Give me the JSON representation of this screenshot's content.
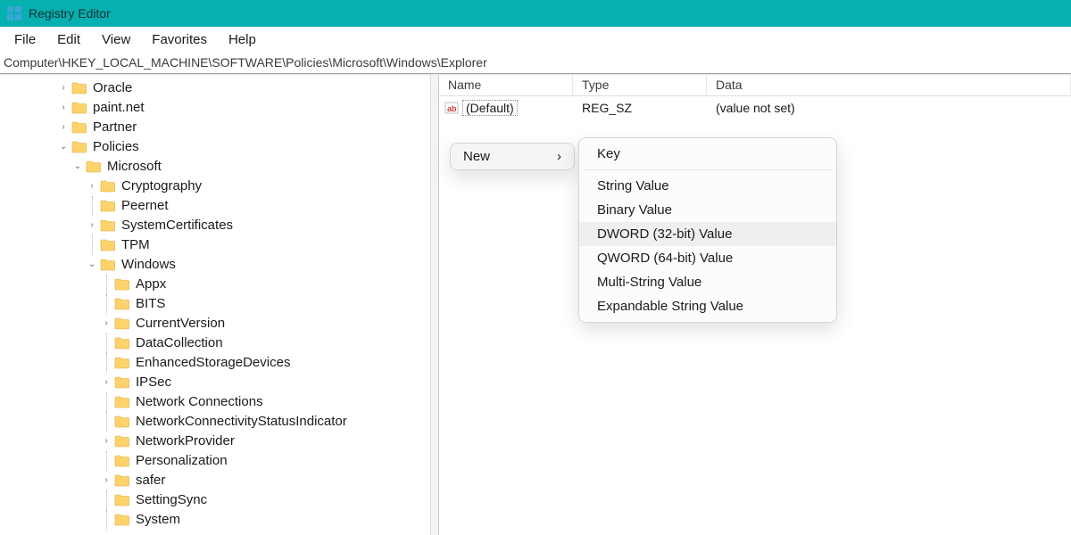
{
  "app": {
    "title": "Registry Editor"
  },
  "menu": {
    "items": [
      "File",
      "Edit",
      "View",
      "Favorites",
      "Help"
    ]
  },
  "path": "Computer\\HKEY_LOCAL_MACHINE\\SOFTWARE\\Policies\\Microsoft\\Windows\\Explorer",
  "tree": [
    {
      "indent": 4,
      "expander": ">",
      "label": "Oracle"
    },
    {
      "indent": 4,
      "expander": ">",
      "label": "paint.net"
    },
    {
      "indent": 4,
      "expander": ">",
      "label": "Partner"
    },
    {
      "indent": 4,
      "expander": "v",
      "label": "Policies"
    },
    {
      "indent": 5,
      "expander": "v",
      "label": "Microsoft"
    },
    {
      "indent": 6,
      "expander": ">",
      "label": "Cryptography"
    },
    {
      "indent": 6,
      "expander": "",
      "label": "Peernet",
      "dotted": true
    },
    {
      "indent": 6,
      "expander": ">",
      "label": "SystemCertificates"
    },
    {
      "indent": 6,
      "expander": "",
      "label": "TPM",
      "dotted": true
    },
    {
      "indent": 6,
      "expander": "v",
      "label": "Windows"
    },
    {
      "indent": 7,
      "expander": "",
      "label": "Appx",
      "dotted": true
    },
    {
      "indent": 7,
      "expander": "",
      "label": "BITS",
      "dotted": true
    },
    {
      "indent": 7,
      "expander": ">",
      "label": "CurrentVersion"
    },
    {
      "indent": 7,
      "expander": "",
      "label": "DataCollection",
      "dotted": true
    },
    {
      "indent": 7,
      "expander": "",
      "label": "EnhancedStorageDevices",
      "dotted": true
    },
    {
      "indent": 7,
      "expander": ">",
      "label": "IPSec"
    },
    {
      "indent": 7,
      "expander": "",
      "label": "Network Connections",
      "dotted": true
    },
    {
      "indent": 7,
      "expander": "",
      "label": "NetworkConnectivityStatusIndicator",
      "dotted": true
    },
    {
      "indent": 7,
      "expander": ">",
      "label": "NetworkProvider"
    },
    {
      "indent": 7,
      "expander": "",
      "label": "Personalization",
      "dotted": true
    },
    {
      "indent": 7,
      "expander": ">",
      "label": "safer"
    },
    {
      "indent": 7,
      "expander": "",
      "label": "SettingSync",
      "dotted": true
    },
    {
      "indent": 7,
      "expander": "",
      "label": "System",
      "dotted": true
    }
  ],
  "columns": {
    "name": "Name",
    "type": "Type",
    "data": "Data"
  },
  "values": [
    {
      "name": "(Default)",
      "type": "REG_SZ",
      "data": "(value not set)"
    }
  ],
  "context": {
    "primary": {
      "label": "New",
      "arrow": "›"
    },
    "items": [
      {
        "label": "Key",
        "sep_after": true
      },
      {
        "label": "String Value"
      },
      {
        "label": "Binary Value"
      },
      {
        "label": "DWORD (32-bit) Value",
        "hover": true
      },
      {
        "label": "QWORD (64-bit) Value"
      },
      {
        "label": "Multi-String Value"
      },
      {
        "label": "Expandable String Value"
      }
    ]
  }
}
